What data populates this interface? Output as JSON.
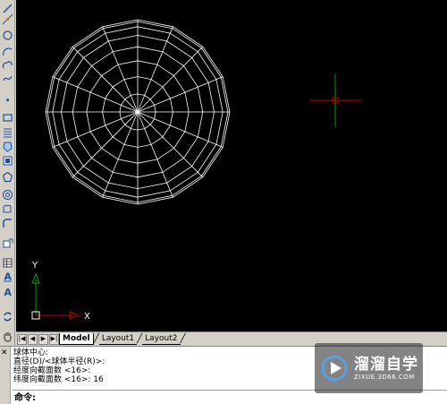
{
  "toolbar": {
    "tools": [
      {
        "name": "line-icon"
      },
      {
        "name": "construction-line-icon"
      },
      {
        "name": "circle-icon"
      },
      {
        "name": "arc-icon"
      },
      {
        "name": "polyline-icon"
      },
      {
        "name": "spline-icon"
      },
      {
        "name": "point-icon"
      },
      {
        "name": "rectangle-icon"
      },
      {
        "name": "hatch-icon"
      },
      {
        "name": "region-icon"
      },
      {
        "name": "block-icon"
      },
      {
        "name": "polygon-icon"
      },
      {
        "name": "donut-icon"
      },
      {
        "name": "revision-cloud-icon"
      },
      {
        "name": "ellipse-arc-icon"
      },
      {
        "name": "insert-block-icon"
      },
      {
        "name": "table-icon"
      },
      {
        "name": "multiline-text-icon"
      },
      {
        "name": "text-icon"
      },
      {
        "name": "refresh-icon"
      },
      {
        "name": "pan-hand-icon"
      }
    ]
  },
  "viewport": {
    "background": "#000000",
    "sphere_color": "#ffffff",
    "crosshair_h_color": "#c00000",
    "crosshair_v_color": "#00a000",
    "ucs_x_color": "#c00000",
    "ucs_y_color": "#00a000",
    "ucs_x_label": "X",
    "ucs_y_label": "Y"
  },
  "tabs": {
    "items": [
      {
        "label": "Model",
        "active": true
      },
      {
        "label": "Layout1",
        "active": false
      },
      {
        "label": "Layout2",
        "active": false
      }
    ]
  },
  "command": {
    "history": [
      "球体中心:",
      "直径(D)/<球体半径(R)>:",
      "经度向截面数 <16>:",
      "纬度向截面数 <16>: 16"
    ],
    "prompt": "命令:",
    "input_value": ""
  },
  "watermark": {
    "title": "溜溜自学",
    "subtitle": "ZIXUE.3D66.COM",
    "accent": "#5aa0e0"
  }
}
